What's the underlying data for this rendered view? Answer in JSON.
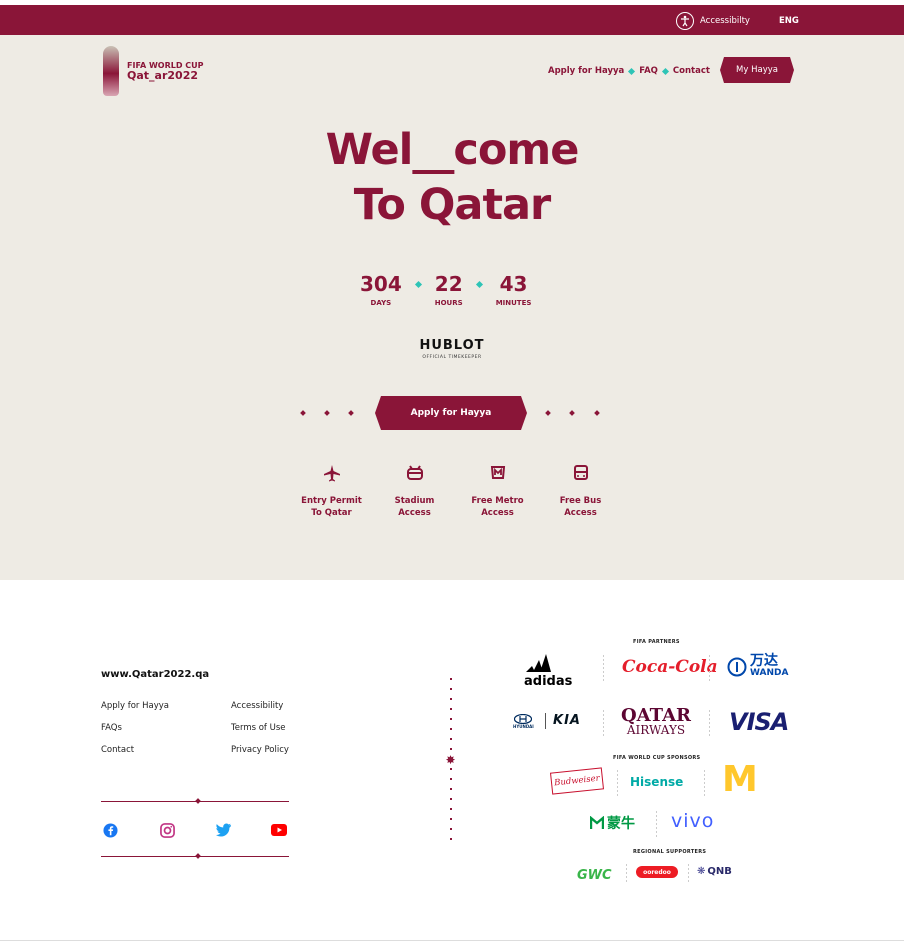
{
  "topbar": {
    "accessibility_label": "Accessibilty",
    "language": "ENG"
  },
  "logo": {
    "line1": "FIFA WORLD CUP",
    "line2": "Qat_ar2022"
  },
  "nav": {
    "items": [
      "Apply for Hayya",
      "FAQ",
      "Contact"
    ],
    "cta": "My Hayya"
  },
  "hero": {
    "title_line1": "Wel__come",
    "title_line2": "To Qatar",
    "countdown": [
      {
        "value": "304",
        "label": "DAYS"
      },
      {
        "value": "22",
        "label": "HOURS"
      },
      {
        "value": "43",
        "label": "MINUTES"
      }
    ],
    "timekeeper": {
      "name": "HUBLOT",
      "subtitle": "OFFICIAL TIMEKEEPER"
    },
    "apply_button": "Apply for Hayya",
    "benefits": [
      {
        "icon": "airplane-icon",
        "label": "Entry Permit\nTo Qatar"
      },
      {
        "icon": "stadium-icon",
        "label": "Stadium\nAccess"
      },
      {
        "icon": "metro-icon",
        "label": "Free Metro\nAccess"
      },
      {
        "icon": "bus-icon",
        "label": "Free Bus\nAccess"
      }
    ]
  },
  "footer": {
    "site": "www.Qatar2022.qa",
    "links": [
      "Apply for Hayya",
      "Accessibility",
      "FAQs",
      "Terms of Use",
      "Contact",
      "Privacy Policy"
    ],
    "social": [
      "facebook-icon",
      "instagram-icon",
      "twitter-icon",
      "youtube-icon"
    ],
    "sections": {
      "partners": "FIFA PARTNERS",
      "sponsors": "FIFA WORLD CUP SPONSORS",
      "regional": "REGIONAL SUPPORTERS"
    },
    "brands": {
      "adidas": "adidas",
      "cocacola": "Coca-Cola",
      "wanda_cn": "万达",
      "wanda_en": "WANDA",
      "hyundai": "HYUNDAI",
      "kia": "KIA",
      "qatar_airways_1": "QATAR",
      "qatar_airways_2": "AIRWAYS",
      "visa": "VISA",
      "budweiser": "Budweiser",
      "hisense": "Hisense",
      "mcdonalds": "M",
      "mengniu": "蒙牛",
      "vivo": "vivo",
      "gwc": "GWC",
      "ooredoo": "ooredoo",
      "qnb": "QNB"
    }
  },
  "colors": {
    "maroon": "#8a1538",
    "teal": "#2ec4b6",
    "cream": "#eeebe4"
  }
}
